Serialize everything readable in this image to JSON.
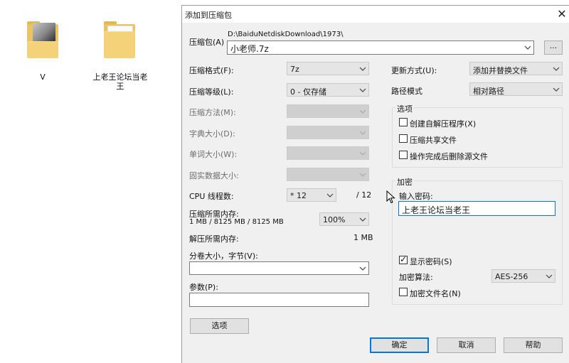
{
  "desktop": {
    "items": [
      {
        "label": "V"
      },
      {
        "label": "上老王论坛当老王"
      }
    ]
  },
  "dialog": {
    "title": "添加到压缩包",
    "close_glyph": "✕",
    "archive_label": "压缩包(A)",
    "archive_path": "D:\\BaiduNetdiskDownload\\1973\\",
    "archive_name": "小老师.7z",
    "browse_label": "...",
    "format_label": "压缩格式(F):",
    "format_value": "7z",
    "level_label": "压缩等级(L):",
    "level_value": "0 - 仅存储",
    "method_label": "压缩方法(M):",
    "dict_label": "字典大小(D):",
    "word_label": "单词大小(W):",
    "solid_label": "固实数据大小:",
    "cpu_label": "CPU 线程数:",
    "cpu_value": "* 12",
    "cpu_total": "/ 12",
    "mem_comp_label": "压缩所需内存:",
    "mem_comp_value": "1 MB / 8125 MB / 8125 MB",
    "mem_percent": "100%",
    "mem_decomp_label": "解压所需内存:",
    "mem_decomp_value": "1 MB",
    "volume_label": "分卷大小，字节(V):",
    "volume_value": "",
    "params_label": "参数(P):",
    "params_value": "",
    "options_button": "选项",
    "update_label": "更新方式(U):",
    "update_value": "添加并替换文件",
    "path_label": "路径模式",
    "path_value": "相对路径",
    "options_group": {
      "title": "选项",
      "sfx": "创建自解压程序(X)",
      "shared": "压缩共享文件",
      "delete": "操作完成后删除源文件"
    },
    "encryption_group": {
      "title": "加密",
      "password_label": "输入密码:",
      "password_value": "上老王论坛当老王",
      "show_password": "显示密码(S)",
      "show_password_checked": true,
      "method_label": "加密算法:",
      "method_value": "AES-256",
      "encrypt_names": "加密文件名(N)",
      "check_mark": "✓"
    },
    "ok_label": "确定",
    "cancel_label": "取消",
    "help_label": "帮助"
  }
}
